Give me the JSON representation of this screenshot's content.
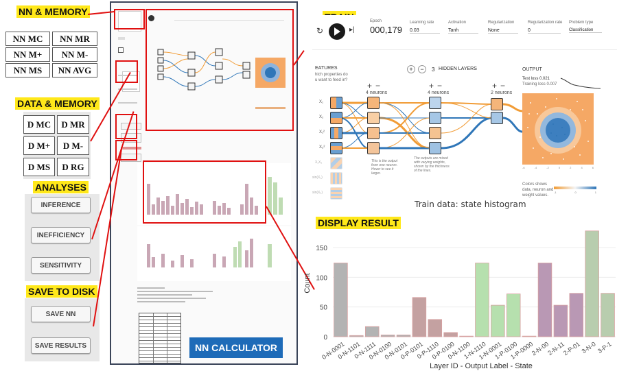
{
  "sections": {
    "nn_memory": "NN & MEMORY",
    "data_memory": "DATA & MEMORY",
    "analyses": "ANALYSES",
    "save_to_disk": "SAVE TO DISK",
    "train": "TRAIN",
    "display_result": "DISPLAY RESULT",
    "nn_calculator": "NN CALCULATOR"
  },
  "nn_buttons": [
    "NN MC",
    "NN MR",
    "NN M+",
    "NN M-",
    "NN MS",
    "NN AVG"
  ],
  "data_buttons": [
    "D MC",
    "D MR",
    "D M+",
    "D M-",
    "D MS",
    "D RG"
  ],
  "analysis_buttons": [
    "INFERENCE",
    "INEFFICIENCY",
    "SENSITIVITY"
  ],
  "save_buttons": [
    "SAVE NN",
    "SAVE RESULTS"
  ],
  "train_panel": {
    "epoch_label": "Epoch",
    "epoch_value": "000,179",
    "learning_rate_label": "Learning rate",
    "learning_rate_value": "0.03",
    "activation_label": "Activation",
    "activation_value": "Tanh",
    "regularization_label": "Regularization",
    "regularization_value": "None",
    "reg_rate_label": "Regularization rate",
    "reg_rate_value": "0",
    "problem_type_label": "Problem type",
    "problem_type_value": "Classification",
    "features_title": "EATURES",
    "features_subtitle_1": "hich properties do",
    "features_subtitle_2": "u want to feed in?",
    "hidden_layers_count": "3",
    "hidden_layers_label": "HIDDEN LAYERS",
    "layer_neurons": [
      "4 neurons",
      "4 neurons",
      "2 neurons"
    ],
    "output_title": "OUTPUT",
    "test_loss": "Test loss 0.021",
    "training_loss": "Training loss 0.007",
    "feature_labels": [
      "X₁",
      "X₂",
      "X₁²",
      "X₂²",
      "X₁X₂",
      "sin(X₁)",
      "sin(X₂)"
    ],
    "note_output": "This is the output from one neuron. Hover to see it larger.",
    "note_weights": "The outputs are mixed with varying weights, shown by the thickness of the lines.",
    "colors_note_1": "Colors shows",
    "colors_note_2": "data, neuron and",
    "colors_note_3": "weight values.",
    "colorbar_ticks": [
      "-1",
      "0",
      "1"
    ],
    "axis_ticks": [
      "-6",
      "-5",
      "-4",
      "-3",
      "-2",
      "-1",
      "0",
      "1",
      "2",
      "3",
      "4",
      "5",
      "6"
    ],
    "icons": [
      "reset-icon",
      "play-icon",
      "step-icon"
    ]
  },
  "histogram_title": "Train data: state histogram",
  "chart_data": {
    "type": "bar",
    "title": "Train data: state histogram",
    "xlabel": "Layer ID - Output Label - State",
    "ylabel": "Count",
    "ylim": [
      0,
      180
    ],
    "yticks": [
      0,
      50,
      100,
      150
    ],
    "categories": [
      "0-N-0001",
      "0-N-1101",
      "0-N-1111",
      "0-N-0100",
      "0-N-0101",
      "0-P-0101",
      "0-P-1110",
      "0-P-0100",
      "0-N-1100",
      "1-N-1110",
      "1-N-0001",
      "1-P-0100",
      "1-P-0000",
      "2-N-00",
      "2-N-11",
      "2-P-01",
      "3-N-0",
      "3-P-1"
    ],
    "values": [
      124,
      2,
      17,
      3,
      3,
      66,
      29,
      7,
      1,
      124,
      53,
      72,
      1,
      124,
      53,
      73,
      178,
      73
    ],
    "colors": [
      "#b3b3b3",
      "#b3b3b3",
      "#b3b3b3",
      "#b3b3b3",
      "#b3b3b3",
      "#c4a1a1",
      "#c4a1a1",
      "#c4a1a1",
      "#b3b3b3",
      "#b6e0ae",
      "#b6e0ae",
      "#b6e0ae",
      "#b6e0ae",
      "#b998b4",
      "#b998b4",
      "#b998b4",
      "#b8cdae",
      "#b8cdae"
    ]
  },
  "colors": {
    "highlight_red": "#e01010",
    "label_yellow": "#ffe81a",
    "calculator_blue": "#1e6bb8",
    "orange": "#f19c36",
    "blue": "#2f76b8"
  }
}
